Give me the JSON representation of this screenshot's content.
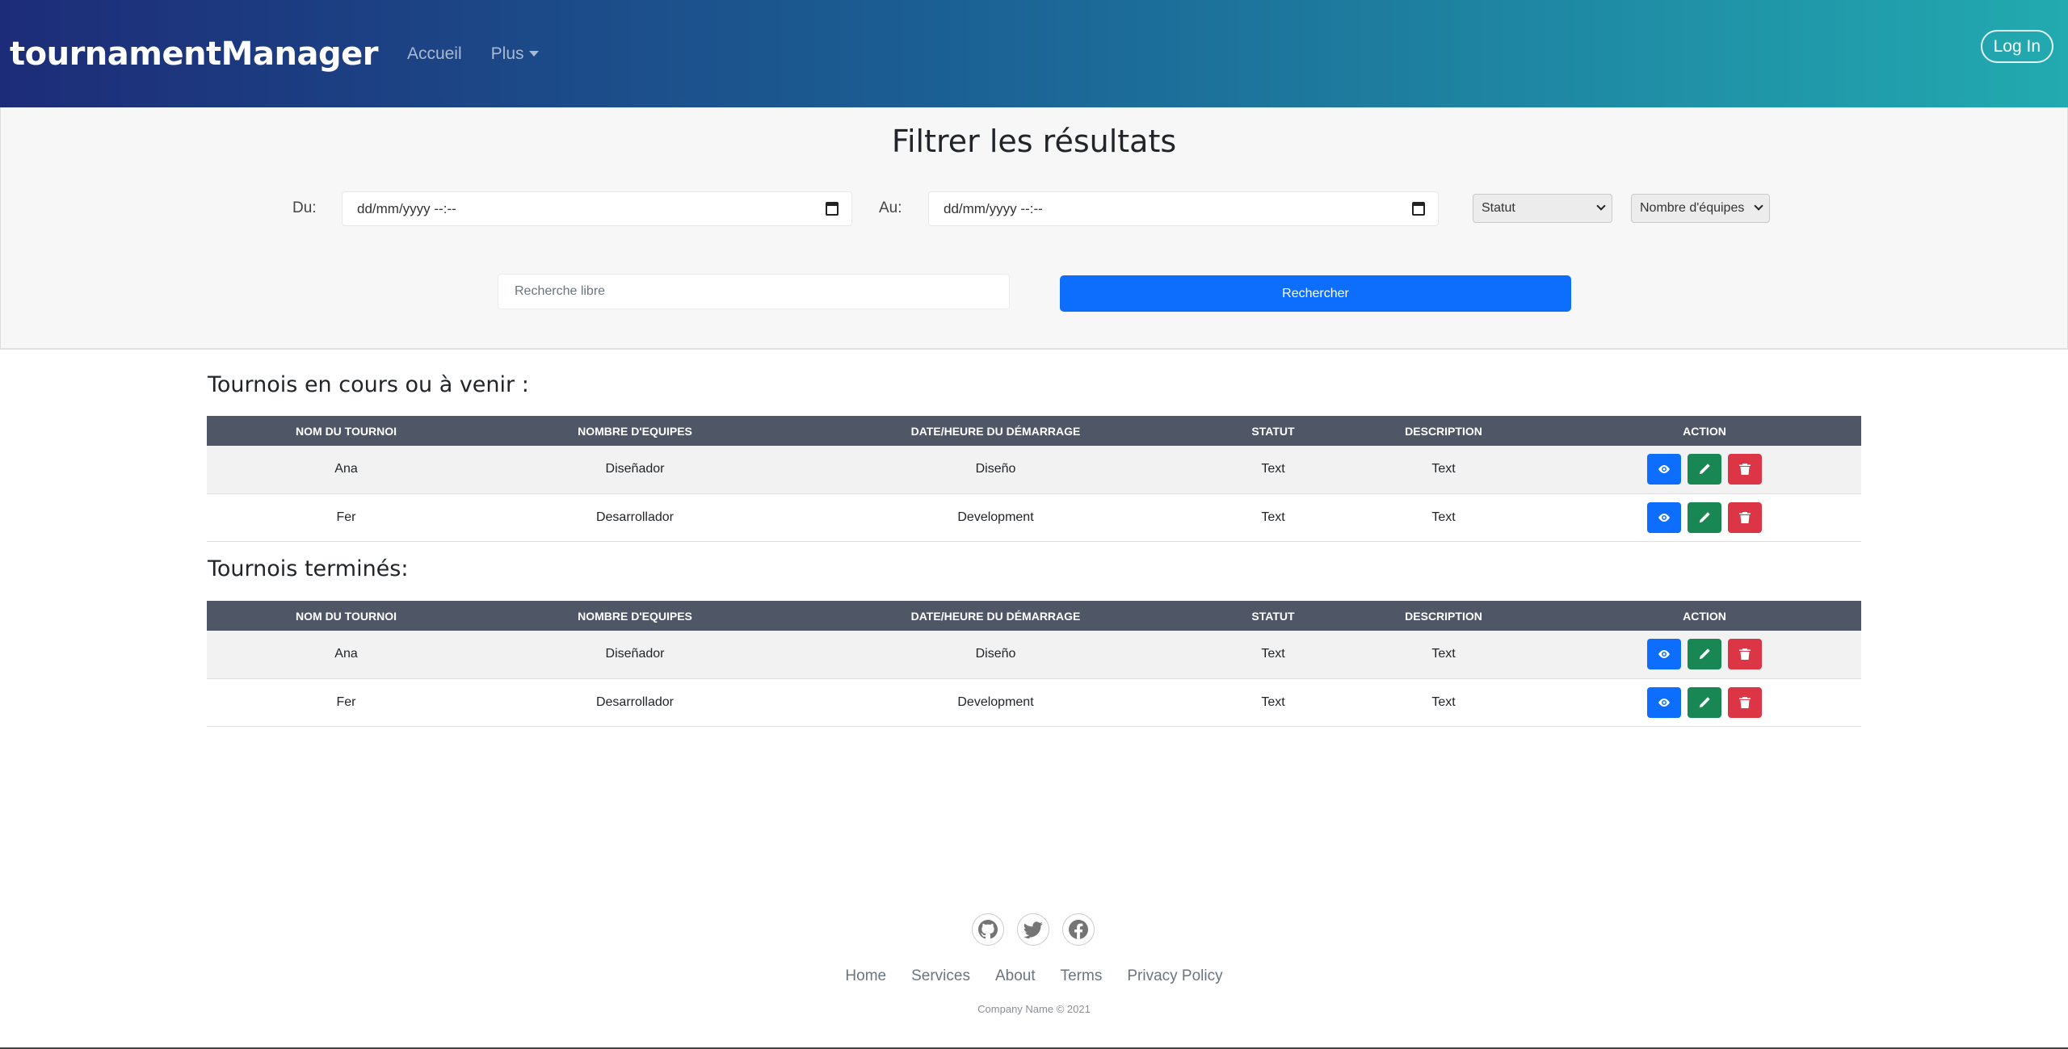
{
  "navbar": {
    "brand": "tournamentManager",
    "links": [
      "Accueil",
      "Plus"
    ],
    "login_label": "Log In"
  },
  "filter": {
    "title": "Filtrer les résultats",
    "from_label": "Du:",
    "to_label": "Au:",
    "date_placeholder": "dd/mm/yyyy --:--",
    "status_select": "Statut",
    "teams_select": "Nombre d'équipes",
    "search_placeholder": "Recherche libre",
    "search_button": "Rechercher"
  },
  "table_headers": [
    "Nom du tournoi",
    "Nombre d'equipes",
    "Date/heure du démarrage",
    "Statut",
    "Description",
    "Action"
  ],
  "current": {
    "title": "Tournois en cours ou à venir :",
    "rows": [
      {
        "name": "Ana",
        "teams": "Diseñador",
        "date": "Diseño",
        "status": "Text",
        "description": "Text"
      },
      {
        "name": "Fer",
        "teams": "Desarrollador",
        "date": "Development",
        "status": "Text",
        "description": "Text"
      }
    ]
  },
  "finished": {
    "title": "Tournois terminés:",
    "rows": [
      {
        "name": "Ana",
        "teams": "Diseñador",
        "date": "Diseño",
        "status": "Text",
        "description": "Text"
      },
      {
        "name": "Fer",
        "teams": "Desarrollador",
        "date": "Development",
        "status": "Text",
        "description": "Text"
      }
    ]
  },
  "footer": {
    "social_icons": [
      "github-icon",
      "twitter-icon",
      "facebook-icon"
    ],
    "links": [
      "Home",
      "Services",
      "About",
      "Terms",
      "Privacy Policy"
    ],
    "copyright": "Company Name © 2021"
  },
  "colors": {
    "view": "#0d6efd",
    "edit": "#198754",
    "delete": "#dc3545",
    "table_header": "#4f5665",
    "primary": "#0d6efd"
  }
}
